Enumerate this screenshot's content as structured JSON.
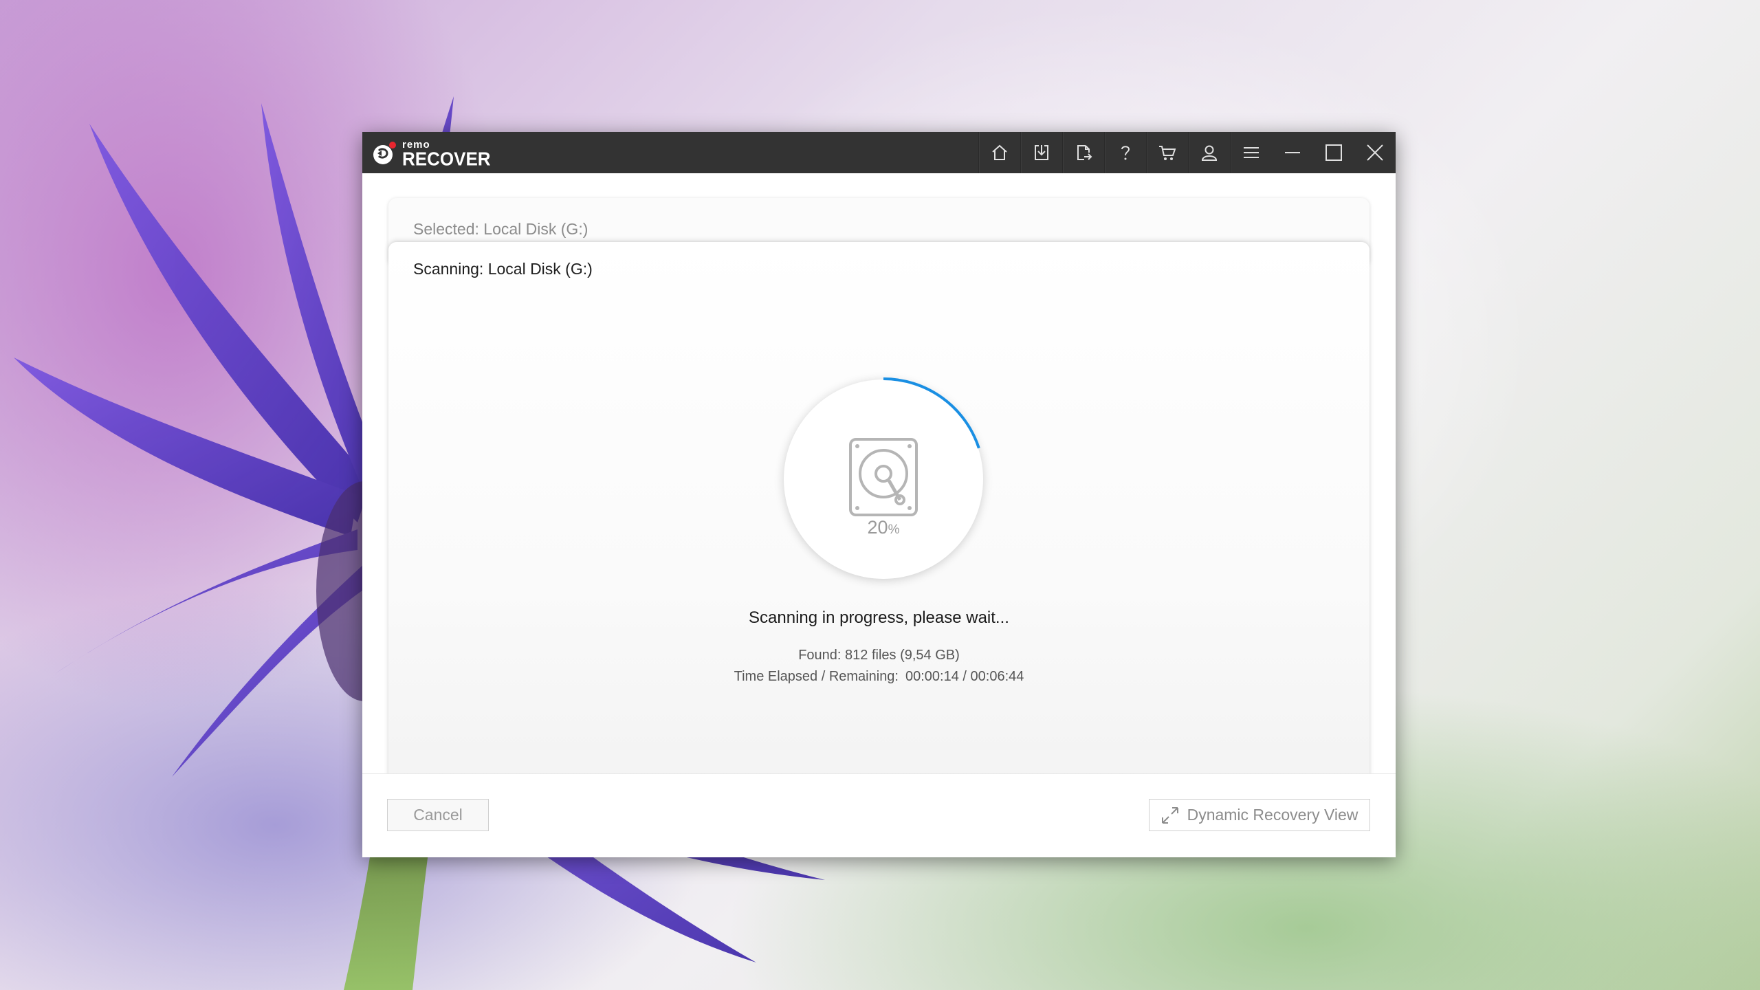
{
  "app": {
    "logo_small": "remo",
    "logo_large": "RECOVER"
  },
  "toolbar": {
    "icons": [
      "home-icon",
      "download-icon",
      "export-icon",
      "help-icon",
      "cart-icon",
      "user-icon",
      "menu-icon",
      "minimize-icon",
      "maximize-icon",
      "close-icon"
    ]
  },
  "selection": {
    "label": "Selected: Local Disk (G:)"
  },
  "scan": {
    "title": "Scanning: Local Disk (G:)",
    "progress_value": "20",
    "progress_unit": "%",
    "progress_fraction": 0.2,
    "status": "Scanning in progress, please wait...",
    "found": "Found: 812 files (9,54 GB)",
    "time_label": "Time Elapsed / Remaining:",
    "time_value": "00:00:14 / 00:06:44"
  },
  "footer": {
    "cancel_label": "Cancel",
    "drv_label": "Dynamic Recovery View"
  },
  "colors": {
    "title_bar": "#333333",
    "progress_arc": "#1a8fe3",
    "logo_accent": "#e8262f"
  }
}
